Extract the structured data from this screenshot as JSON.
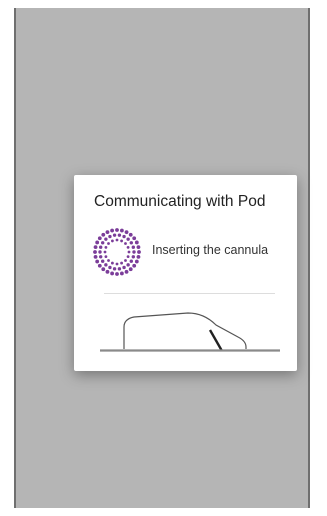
{
  "dialog": {
    "title": "Communicating with Pod",
    "status": "Inserting the cannula"
  },
  "icons": {
    "spinner": "dotted-circle-progress-icon",
    "pod": "pod-cannula-illustration"
  },
  "colors": {
    "accent": "#7b3d99",
    "backdrop": "#b5b5b5"
  }
}
